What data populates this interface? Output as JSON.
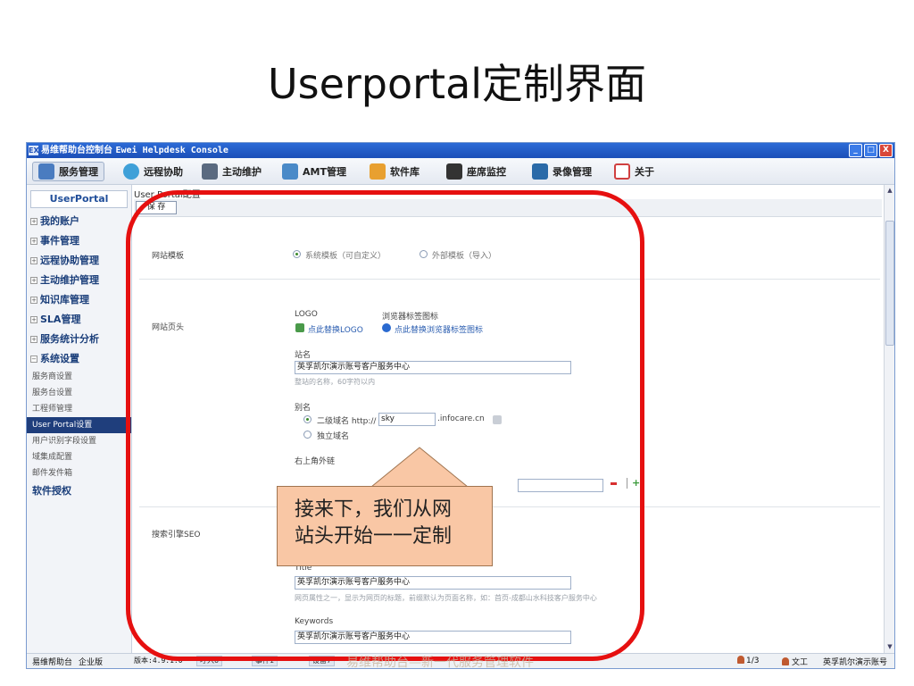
{
  "slide": {
    "title": "Userportal定制界面"
  },
  "window": {
    "title_cn": "易维帮助台控制台 ",
    "title_en": "Ewei Helpdesk Console",
    "logo_text": "EX",
    "controls": {
      "minimize": "_",
      "maximize": "□",
      "close": "X"
    }
  },
  "menu": [
    {
      "label": "服务管理",
      "icon": "service-management-icon",
      "color": "#4a7cc0"
    },
    {
      "label": "远程协助",
      "icon": "remote-assist-icon",
      "color": "#3fa0d8"
    },
    {
      "label": "主动维护",
      "icon": "maintenance-icon",
      "color": "#5a6a80"
    },
    {
      "label": "AMT管理",
      "icon": "amt-icon",
      "color": "#4a8ac8"
    },
    {
      "label": "软件库",
      "icon": "software-library-icon",
      "color": "#e8a030"
    },
    {
      "label": "座席监控",
      "icon": "agent-monitor-icon",
      "color": "#333333"
    },
    {
      "label": "录像管理",
      "icon": "recording-icon",
      "color": "#2a6aa8"
    },
    {
      "label": "关于",
      "icon": "about-icon",
      "color": "#d04040"
    }
  ],
  "sidebar": {
    "header": "UserPortal",
    "items": [
      {
        "label": "我的账户",
        "sign": "+"
      },
      {
        "label": "事件管理",
        "sign": "+"
      },
      {
        "label": "远程协助管理",
        "sign": "+"
      },
      {
        "label": "主动维护管理",
        "sign": "+"
      },
      {
        "label": "知识库管理",
        "sign": "+"
      },
      {
        "label": "SLA管理",
        "sign": "+"
      },
      {
        "label": "服务统计分析",
        "sign": "+"
      },
      {
        "label": "系统设置",
        "sign": "−"
      }
    ],
    "sub_items": [
      "服务商设置",
      "服务台设置",
      "工程师管理",
      "User Portal设置",
      "用户识别字段设置",
      "域集成配置",
      "邮件发件箱"
    ],
    "footer_item": "软件授权"
  },
  "content": {
    "title": "User Portal配置",
    "save_label": "保 存",
    "website_template": {
      "label": "网站模板",
      "option_system": "系统模板（可自定义）",
      "option_external": "外部模板（导入）"
    },
    "website_header": {
      "label": "网站页头",
      "logo_label": "LOGO",
      "favicon_label": "浏览器标签图标",
      "replace_logo": "点此替换LOGO",
      "replace_favicon": "点此替换浏览器标签图标",
      "site_name_label": "站名",
      "site_name_value": "英孚凯尔演示账号客户服务中心",
      "site_name_hint": "整站的名称，60字符以内",
      "alias_label": "别名",
      "alias_option_subdomain": "二级域名 http://",
      "alias_subdomain_value": "sky",
      "alias_domain_suffix": ".infocare.cn",
      "alias_option_independent": "独立域名",
      "top_right_link_label": "右上角外链"
    },
    "seo": {
      "label": "搜索引擎SEO",
      "title_label": "Title",
      "title_value": "英孚凯尔演示账号客户服务中心",
      "title_hint": "网页属性之一，显示为网页的标题，前缀默认为页面名称，如：首页-成都山水科技客户服务中心",
      "keywords_label": "Keywords",
      "keywords_value": "英孚凯尔演示账号客户服务中心"
    }
  },
  "statusbar": {
    "app": "易维帮助台",
    "edition": "企业版",
    "version": "版本:4.9.1.0",
    "incoming": "呼入0",
    "events": "事件1",
    "devices": "设备7",
    "page_count": "1/3",
    "user": "文工",
    "account": "英孚凯尔演示账号"
  },
  "callout": {
    "line1": "接来下，我们从网",
    "line2": "站头开始一一定制"
  },
  "watermark": "易维帮助台—新一代服务管理软件",
  "colors": {
    "highlight_ring": "#e61010",
    "callout_fill": "#f9c7a5",
    "titlebar": "#1c4fb8"
  }
}
